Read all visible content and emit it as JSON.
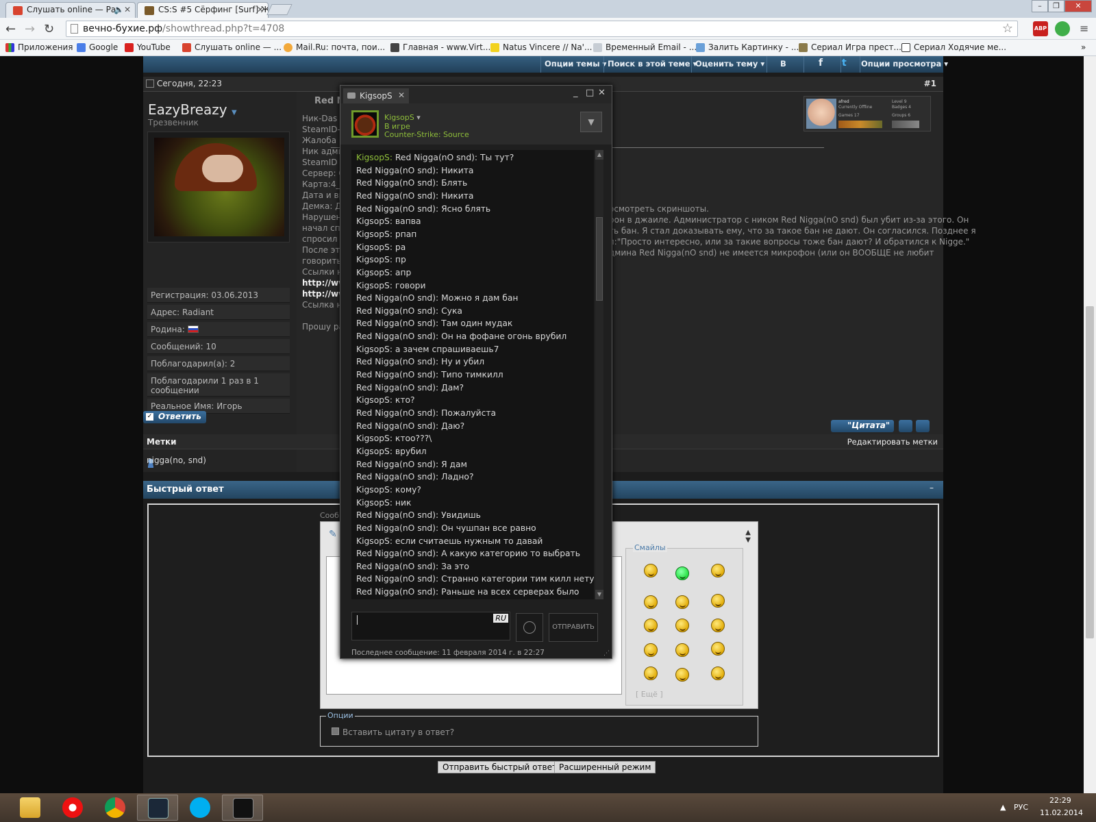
{
  "browser": {
    "tabs": [
      {
        "title": "Слушать online — Ра"
      },
      {
        "title": "CS:S #5 Сёрфинг [Surf] Ж"
      }
    ],
    "url_host": "вечно-бухие.рф",
    "url_path": "/showthread.php?t=4708",
    "bookmarks": [
      {
        "label": "Приложения"
      },
      {
        "label": "Google"
      },
      {
        "label": "YouTube"
      },
      {
        "label": "Слушать online — ..."
      },
      {
        "label": "Mail.Ru: почта, пои..."
      },
      {
        "label": "Главная - www.Virt..."
      },
      {
        "label": "Natus Vincere // Na'..."
      },
      {
        "label": "Временный Email - ..."
      },
      {
        "label": "Залить Картинку - ..."
      },
      {
        "label": "Сериал Игра прест..."
      },
      {
        "label": "Сериал Ходячие ме..."
      }
    ],
    "ext_abp": "ABP"
  },
  "threadbar": {
    "items": [
      "Опции темы ▾",
      "Поиск в этой теме ▾",
      "Оценить тему ▾",
      "B",
      "f",
      "t",
      "Опции просмотра ▾"
    ]
  },
  "post": {
    "date": "Сегодня, 22:23",
    "number": "#1",
    "username": "EazyBreazy",
    "usertitle": "Трезвенник",
    "info": [
      "Регистрация: 03.06.2013",
      "Адрес: Radiant",
      "Родина:",
      "Сообщений: 10",
      "Поблагодарил(а): 2",
      "Поблагодарили 1 раз в 1 сообщении",
      "Реальное Имя: Игорь"
    ],
    "title_fragment": "Red N",
    "left_lines": [
      "Ник-Das @",
      "SteamID-S",
      "Жалоба на",
      "Ник админ",
      "SteamID ад",
      "Сервер: CS",
      "Карта:4_fu",
      "Дата и вре",
      "Демка: Де",
      "Нарушени",
      "начал спр",
      "спросил у",
      "После эти",
      "говорить)",
      "Ссылки на"
    ],
    "links": [
      "http://www",
      "http://www"
    ],
    "link_tail": "Ссылка на",
    "footer_line": "Прошу рас",
    "right_lines": [
      "осмотреть скриншоты.",
      "рон в джаиле. Администратор с ником Red Nigga(nO snd) был убит из-за этого. Он",
      "ть бан. Я стал доказывать ему, что за такое бан не дают. Он согласился. Позднее я",
      "л:\"Просто интересно, или за такие вопросы тоже бан дают? И обратился к Nigge.\"",
      "дмина Red Nigga(nO snd) не имеется микрофон (или он ВООБЩЕ не любит"
    ],
    "quote_label": "\"Цитата\"",
    "reply_label": "Ответить"
  },
  "mini_profile": {
    "name": "afred",
    "status": "Currently Offline",
    "level": "Level 9",
    "badges": "Badges 4",
    "games": "Games 17",
    "groups": "Groups 6"
  },
  "tags": {
    "title": "Метки",
    "edit": "Редактировать метки",
    "value": "nigga(no, snd)"
  },
  "quick_reply": {
    "title": "Быстрый ответ",
    "minimize": "–",
    "message_label": "Сооб",
    "smilies_label": "Смайлы",
    "more_label": "[ Ещё ]",
    "options_label": "Опции",
    "insert_quote": "Вставить цитату в ответ?",
    "submit": "Отправить быстрый ответ",
    "advanced": "Расширенный режим"
  },
  "chat": {
    "tab": "KigsopS",
    "name": "KigsopS",
    "state": "В игре",
    "game": "Counter-Strike: Source",
    "messages": [
      {
        "n": "KigsopS:",
        "t": "Red Nigga(nO snd): Ты тут?",
        "hl": true
      },
      {
        "n": "Red Nigga(nO snd):",
        "t": "Никита"
      },
      {
        "n": "Red Nigga(nO snd):",
        "t": "Блять"
      },
      {
        "n": "Red Nigga(nO snd):",
        "t": "Никита"
      },
      {
        "n": "Red Nigga(nO snd):",
        "t": "Ясно блять"
      },
      {
        "n": "KigsopS:",
        "t": "вапва"
      },
      {
        "n": "KigsopS:",
        "t": "рпап"
      },
      {
        "n": "KigsopS:",
        "t": "ра"
      },
      {
        "n": "KigsopS:",
        "t": "пр"
      },
      {
        "n": "KigsopS:",
        "t": "апр"
      },
      {
        "n": "KigsopS:",
        "t": "говори"
      },
      {
        "n": "Red Nigga(nO snd):",
        "t": "Можно я дам бан"
      },
      {
        "n": "Red Nigga(nO snd):",
        "t": "Сука"
      },
      {
        "n": "Red Nigga(nO snd):",
        "t": "Там один мудак"
      },
      {
        "n": "Red Nigga(nO snd):",
        "t": "Он на фофане огонь врубил"
      },
      {
        "n": "KigsopS:",
        "t": "а зачем спрашиваешь7"
      },
      {
        "n": "Red Nigga(nO snd):",
        "t": "Ну и убил"
      },
      {
        "n": "Red Nigga(nO snd):",
        "t": "Типо тимкилл"
      },
      {
        "n": "Red Nigga(nO snd):",
        "t": "Дам?"
      },
      {
        "n": "KigsopS:",
        "t": "кто?"
      },
      {
        "n": "Red Nigga(nO snd):",
        "t": "Пожалуйста"
      },
      {
        "n": "Red Nigga(nO snd):",
        "t": "Даю?"
      },
      {
        "n": "KigsopS:",
        "t": "ктоо???\\"
      },
      {
        "n": "KigsopS:",
        "t": "врубил"
      },
      {
        "n": "Red Nigga(nO snd):",
        "t": "Я дам"
      },
      {
        "n": "Red Nigga(nO snd):",
        "t": "Ладно?"
      },
      {
        "n": "KigsopS:",
        "t": "кому?"
      },
      {
        "n": "KigsopS:",
        "t": "ник"
      },
      {
        "n": "Red Nigga(nO snd):",
        "t": "Увидишь"
      },
      {
        "n": "Red Nigga(nO snd):",
        "t": "Он чушпан все равно"
      },
      {
        "n": "KigsopS:",
        "t": "если считаешь нужным то давай"
      },
      {
        "n": "Red Nigga(nO snd):",
        "t": "А какую категорию то выбрать"
      },
      {
        "n": "Red Nigga(nO snd):",
        "t": "За это"
      },
      {
        "n": "Red Nigga(nO snd):",
        "t": "Странно категории тим килл нету"
      },
      {
        "n": "Red Nigga(nO snd):",
        "t": "Раньше на всех серверах было"
      }
    ],
    "ime": "RU",
    "send": "ОТПРАВИТЬ",
    "last_message": "Последнее сообщение: 11 февраля 2014 г. в 22:27"
  },
  "taskbar": {
    "lang": "РУС",
    "time": "22:29",
    "date": "11.02.2014"
  }
}
